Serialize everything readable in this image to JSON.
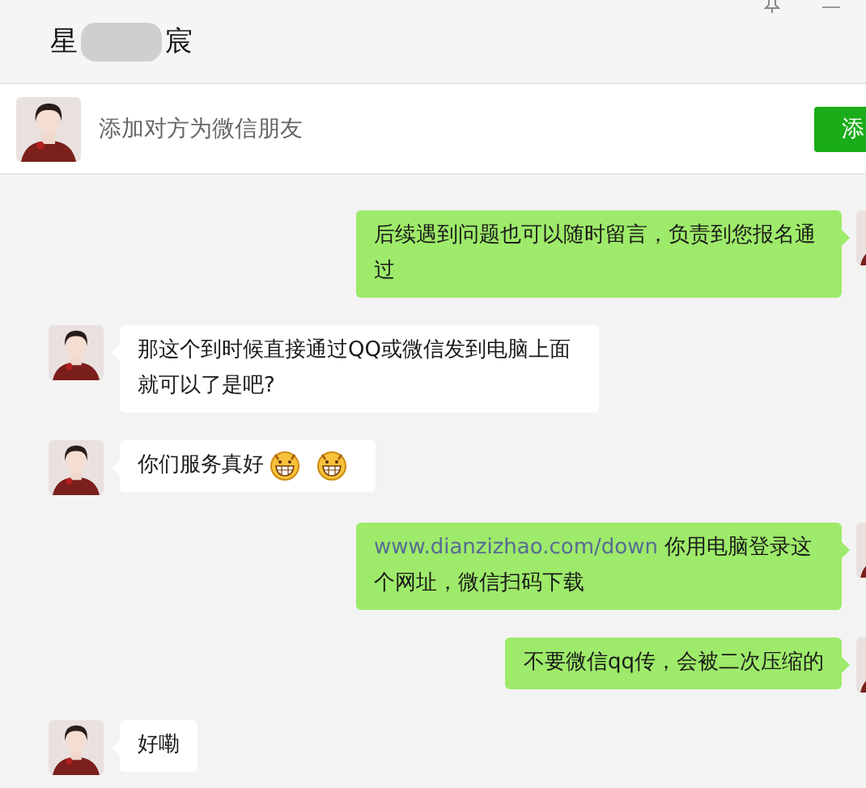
{
  "window": {
    "title_parts": [
      "星",
      "宸"
    ]
  },
  "friend_bar": {
    "prompt": "添加对方为微信朋友",
    "button": "添"
  },
  "messages": [
    {
      "kind": "outgoing",
      "parts": [
        {
          "kind": "text",
          "text": "后续遇到问题也可以随时留言，负责到您报名通过"
        }
      ]
    },
    {
      "kind": "incoming",
      "parts": [
        {
          "kind": "text",
          "text": "那这个到时候直接通过QQ或微信发到电脑上面就可以了是吧?"
        }
      ]
    },
    {
      "kind": "incoming",
      "parts": [
        {
          "kind": "text",
          "text": "你们服务真好"
        },
        {
          "kind": "emoji"
        },
        {
          "kind": "emoji"
        }
      ]
    },
    {
      "kind": "outgoing",
      "parts": [
        {
          "kind": "link",
          "text": "www.dianzizhao.com/down"
        },
        {
          "kind": "text",
          "text": " 你用电脑登录这个网址，微信扫码下载"
        }
      ]
    },
    {
      "kind": "outgoing",
      "parts": [
        {
          "kind": "text",
          "text": "不要微信qq传，会被二次压缩的"
        }
      ]
    },
    {
      "kind": "incoming",
      "parts": [
        {
          "kind": "text",
          "text": "好嘞"
        }
      ]
    }
  ]
}
